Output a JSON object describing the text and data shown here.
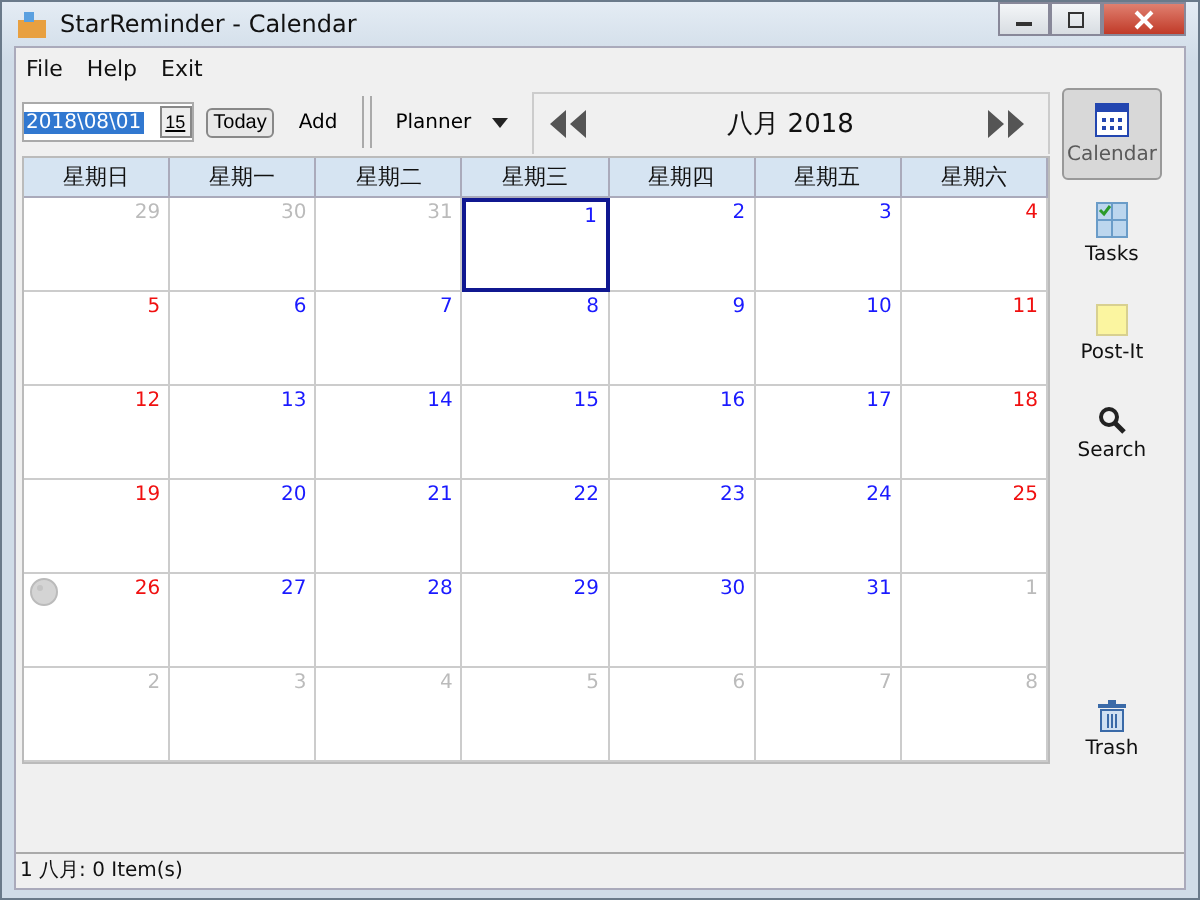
{
  "window": {
    "title": "StarReminder - Calendar"
  },
  "menu": [
    "File",
    "Help",
    "Exit"
  ],
  "toolbar": {
    "date": "2018\\08\\01",
    "date_button": "15",
    "today": "Today",
    "add": "Add",
    "view": "Planner"
  },
  "month_title": "八月 2018",
  "weekdays": [
    "星期日",
    "星期一",
    "星期二",
    "星期三",
    "星期四",
    "星期五",
    "星期六"
  ],
  "days": [
    {
      "label": "29",
      "kind": "other",
      "selected": false,
      "moon": false
    },
    {
      "label": "30",
      "kind": "other",
      "selected": false,
      "moon": false
    },
    {
      "label": "31",
      "kind": "other",
      "selected": false,
      "moon": false
    },
    {
      "label": "1",
      "kind": "weekday",
      "selected": true,
      "moon": false
    },
    {
      "label": "2",
      "kind": "weekday",
      "selected": false,
      "moon": false
    },
    {
      "label": "3",
      "kind": "weekday",
      "selected": false,
      "moon": false
    },
    {
      "label": "4",
      "kind": "weekend",
      "selected": false,
      "moon": false
    },
    {
      "label": "5",
      "kind": "weekend",
      "selected": false,
      "moon": false
    },
    {
      "label": "6",
      "kind": "weekday",
      "selected": false,
      "moon": false
    },
    {
      "label": "7",
      "kind": "weekday",
      "selected": false,
      "moon": false
    },
    {
      "label": "8",
      "kind": "weekday",
      "selected": false,
      "moon": false
    },
    {
      "label": "9",
      "kind": "weekday",
      "selected": false,
      "moon": false
    },
    {
      "label": "10",
      "kind": "weekday",
      "selected": false,
      "moon": false
    },
    {
      "label": "11",
      "kind": "weekend",
      "selected": false,
      "moon": false
    },
    {
      "label": "12",
      "kind": "weekend",
      "selected": false,
      "moon": false
    },
    {
      "label": "13",
      "kind": "weekday",
      "selected": false,
      "moon": false
    },
    {
      "label": "14",
      "kind": "weekday",
      "selected": false,
      "moon": false
    },
    {
      "label": "15",
      "kind": "weekday",
      "selected": false,
      "moon": false
    },
    {
      "label": "16",
      "kind": "weekday",
      "selected": false,
      "moon": false
    },
    {
      "label": "17",
      "kind": "weekday",
      "selected": false,
      "moon": false
    },
    {
      "label": "18",
      "kind": "weekend",
      "selected": false,
      "moon": false
    },
    {
      "label": "19",
      "kind": "weekend",
      "selected": false,
      "moon": false
    },
    {
      "label": "20",
      "kind": "weekday",
      "selected": false,
      "moon": false
    },
    {
      "label": "21",
      "kind": "weekday",
      "selected": false,
      "moon": false
    },
    {
      "label": "22",
      "kind": "weekday",
      "selected": false,
      "moon": false
    },
    {
      "label": "23",
      "kind": "weekday",
      "selected": false,
      "moon": false
    },
    {
      "label": "24",
      "kind": "weekday",
      "selected": false,
      "moon": false
    },
    {
      "label": "25",
      "kind": "weekend",
      "selected": false,
      "moon": false
    },
    {
      "label": "26",
      "kind": "weekend",
      "selected": false,
      "moon": true
    },
    {
      "label": "27",
      "kind": "weekday",
      "selected": false,
      "moon": false
    },
    {
      "label": "28",
      "kind": "weekday",
      "selected": false,
      "moon": false
    },
    {
      "label": "29",
      "kind": "weekday",
      "selected": false,
      "moon": false
    },
    {
      "label": "30",
      "kind": "weekday",
      "selected": false,
      "moon": false
    },
    {
      "label": "31",
      "kind": "weekday",
      "selected": false,
      "moon": false
    },
    {
      "label": "1",
      "kind": "other",
      "selected": false,
      "moon": false
    },
    {
      "label": "2",
      "kind": "other",
      "selected": false,
      "moon": false
    },
    {
      "label": "3",
      "kind": "other",
      "selected": false,
      "moon": false
    },
    {
      "label": "4",
      "kind": "other",
      "selected": false,
      "moon": false
    },
    {
      "label": "5",
      "kind": "other",
      "selected": false,
      "moon": false
    },
    {
      "label": "6",
      "kind": "other",
      "selected": false,
      "moon": false
    },
    {
      "label": "7",
      "kind": "other",
      "selected": false,
      "moon": false
    },
    {
      "label": "8",
      "kind": "other",
      "selected": false,
      "moon": false
    }
  ],
  "sidebar": [
    {
      "label": "Calendar",
      "kind": "calendar",
      "selected": true
    },
    {
      "label": "Tasks",
      "kind": "tasks",
      "selected": false
    },
    {
      "label": "Post-It",
      "kind": "postit",
      "selected": false
    },
    {
      "label": "Search",
      "kind": "search",
      "selected": false
    },
    {
      "label": "Trash",
      "kind": "trash",
      "selected": false
    }
  ],
  "status_bar": "1 八月: 0 Item(s)"
}
